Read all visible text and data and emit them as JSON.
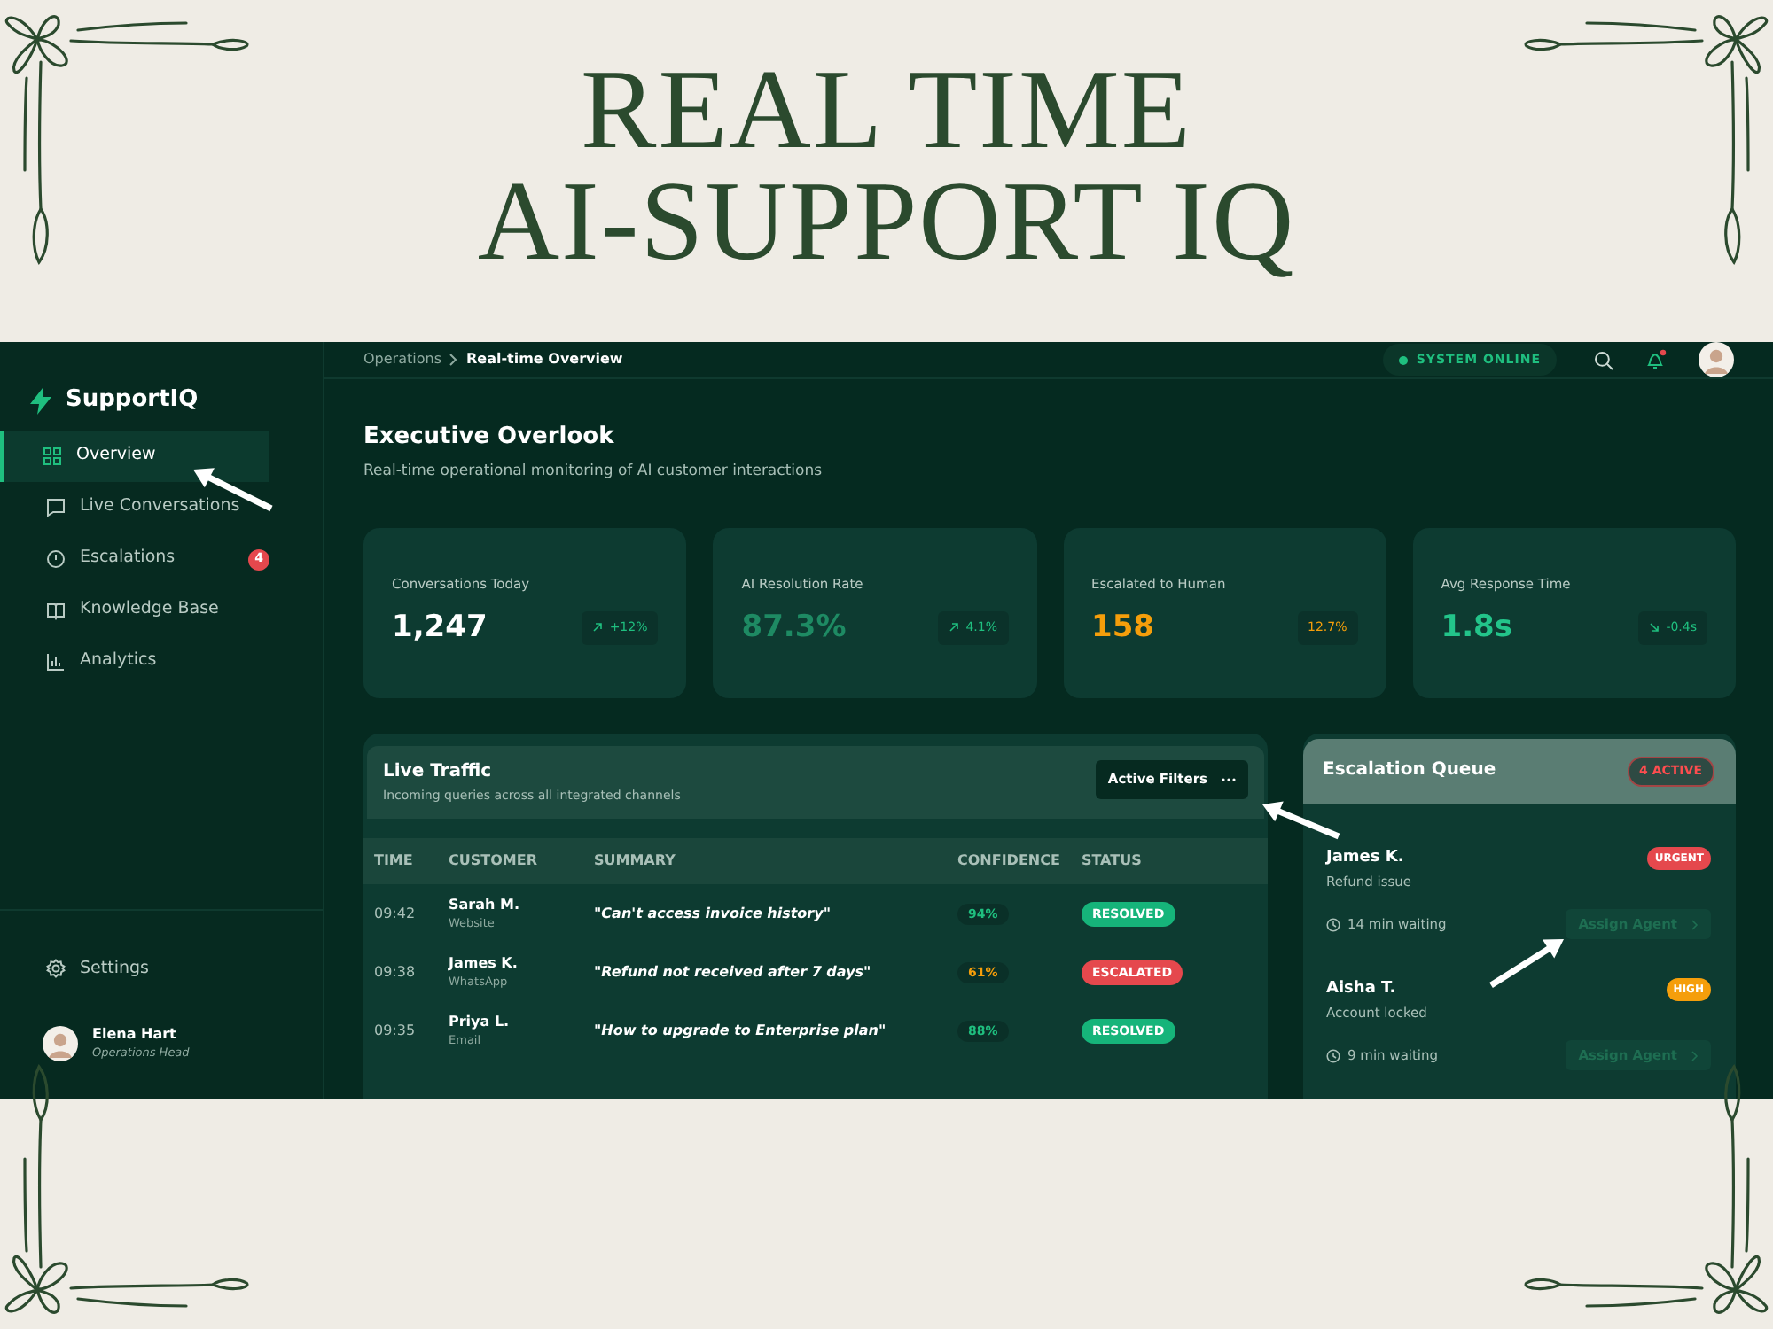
{
  "headline": [
    "REAL TIME",
    "AI-SUPPORT IQ"
  ],
  "sidebar": {
    "brand": "SupportIQ",
    "items": [
      {
        "label": "Overview",
        "selected": true
      },
      {
        "label": "Live Conversations",
        "selected": false
      },
      {
        "label": "Escalations",
        "selected": false,
        "badge": "4"
      },
      {
        "label": "Knowledge Base",
        "selected": false
      },
      {
        "label": "Analytics",
        "selected": false
      }
    ],
    "settings": "Settings",
    "user": {
      "name": "Elena Hart",
      "role": "Operations Head"
    }
  },
  "header": {
    "breadcrumb": [
      "Operations",
      "Real-time Overview"
    ],
    "status": "SYSTEM ONLINE",
    "notification": true
  },
  "page": {
    "title": "Executive Overlook",
    "subtitle": "Real-time operational monitoring of AI customer interactions"
  },
  "stats": [
    {
      "label": "Conversations Today",
      "value": {
        "text": "1,247",
        "color": "#ffffff"
      },
      "delta": {
        "text": "+12%",
        "color": "#1fbf7f"
      },
      "kind": "up"
    },
    {
      "label": "AI Resolution Rate",
      "value": {
        "text": "87.3%",
        "color": "#1e8a63"
      },
      "delta": {
        "text": "4.1%",
        "color": "#1fbf7f"
      },
      "kind": "up"
    },
    {
      "label": "Escalated to Human",
      "value": {
        "text": "158",
        "color": "#f59e0b"
      },
      "delta": {
        "text": "12.7%",
        "color": "#f59e0b"
      },
      "kind": "flat"
    },
    {
      "label": "Avg Response Time",
      "value": {
        "text": "1.8s",
        "color": "#23c48a"
      },
      "delta": {
        "text": "-0.4s",
        "color": "#1fbf7f"
      },
      "kind": "down"
    }
  ],
  "live_traffic": {
    "title": "Live Traffic",
    "subtitle": "Incoming queries across all integrated channels",
    "filter_button": "Active Filters",
    "columns": [
      "TIME",
      "CUSTOMER",
      "SUMMARY",
      "CONFIDENCE",
      "STATUS"
    ],
    "rows": [
      {
        "time": "09:42",
        "customer": "Sarah M.",
        "channel": "Website",
        "summary": "\"Can't access invoice history\"",
        "confidence": {
          "text": "94%",
          "color": "#1fbf7f"
        },
        "status": {
          "text": "RESOLVED",
          "color": "#16b47a"
        }
      },
      {
        "time": "09:38",
        "customer": "James K.",
        "channel": "WhatsApp",
        "summary": "\"Refund not received after 7 days\"",
        "confidence": {
          "text": "61%",
          "color": "#f59e0b"
        },
        "status": {
          "text": "ESCALATED",
          "color": "#e5484d"
        }
      },
      {
        "time": "09:35",
        "customer": "Priya L.",
        "channel": "Email",
        "summary": "\"How to upgrade to Enterprise plan\"",
        "confidence": {
          "text": "88%",
          "color": "#1fbf7f"
        },
        "status": {
          "text": "RESOLVED",
          "color": "#16b47a"
        }
      }
    ]
  },
  "escalation_queue": {
    "title": "Escalation Queue",
    "active": "4 ACTIVE",
    "items": [
      {
        "name": "James K.",
        "issue": "Refund issue",
        "priority": {
          "text": "URGENT",
          "color": "#e5484d"
        },
        "waiting": "14 min waiting",
        "action": "Assign Agent",
        "disabled": true
      },
      {
        "name": "Aisha T.",
        "issue": "Account locked",
        "priority": {
          "text": "HIGH",
          "color": "#f59e0b"
        },
        "waiting": "9 min waiting",
        "action": "Assign Agent",
        "disabled": true
      }
    ]
  }
}
